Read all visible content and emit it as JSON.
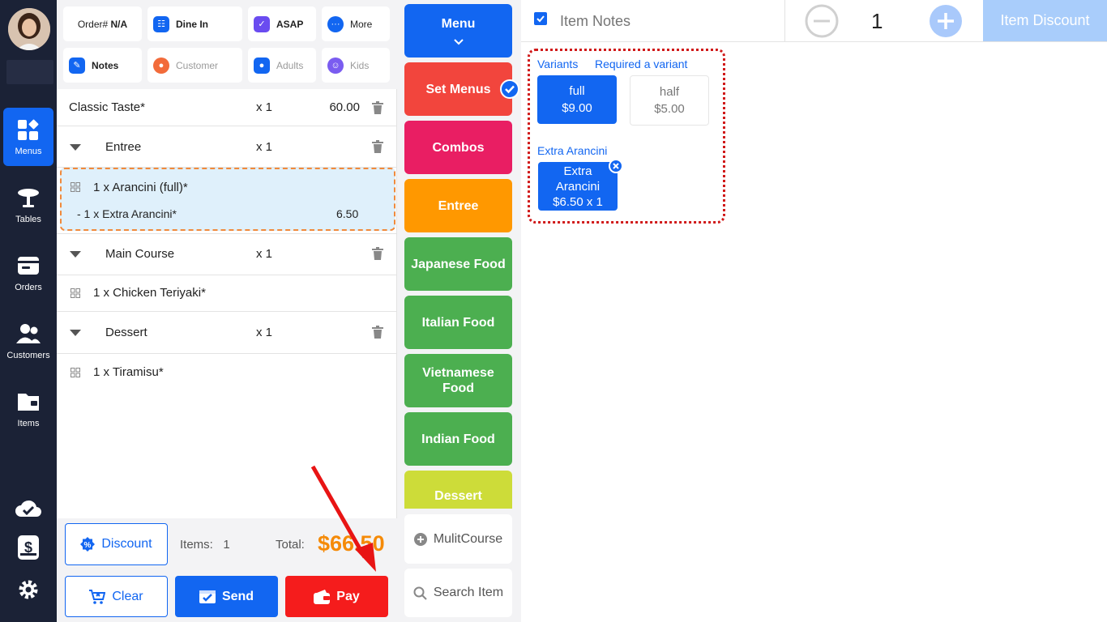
{
  "sidebar": {
    "nav": [
      {
        "label": "Menus",
        "icon": "menus-icon",
        "active": true
      },
      {
        "label": "Tables",
        "icon": "table-icon",
        "active": false
      },
      {
        "label": "Orders",
        "icon": "orders-icon",
        "active": false
      },
      {
        "label": "Customers",
        "icon": "customers-icon",
        "active": false
      },
      {
        "label": "Items",
        "icon": "folder-icon",
        "active": false
      }
    ]
  },
  "order_header": {
    "order_prefix": "Order#",
    "order_number": "N/A",
    "dine_in": "Dine In",
    "asap": "ASAP",
    "more": "More",
    "notes": "Notes",
    "customer": "Customer",
    "adults": "Adults",
    "kids": "Kids"
  },
  "order_lines": {
    "classic_name": "Classic Taste*",
    "classic_qty": "x 1",
    "classic_price": "60.00",
    "entree_name": "Entree",
    "entree_qty": "x 1",
    "arancini_name": "1 x Arancini (full)*",
    "extra_arancini_name": "- 1 x Extra Arancini*",
    "extra_arancini_price": "6.50",
    "main_name": "Main Course",
    "main_qty": "x 1",
    "teriyaki_name": "1 x Chicken Teriyaki*",
    "dessert_name": "Dessert",
    "dessert_qty": "x 1",
    "tiramisu_name": "1 x Tiramisu*"
  },
  "summary": {
    "discount_label": "Discount",
    "items_label": "Items:",
    "items_count": "1",
    "total_label": "Total:",
    "total_value": "$66.50",
    "clear_label": "Clear",
    "send_label": "Send",
    "pay_label": "Pay"
  },
  "categories": {
    "menu": "Menu",
    "set_menus": "Set Menus",
    "combos": "Combos",
    "entree": "Entree",
    "japanese": "Japanese Food",
    "italian": "Italian Food",
    "vietnamese": "Vietnamese Food",
    "indian": "Indian Food",
    "dessert": "Dessert",
    "multicourse": "MulitCourse",
    "search": "Search Item"
  },
  "item_panel": {
    "item_notes_placeholder": "Item Notes",
    "quantity": "1",
    "item_discount": "Item Discount",
    "variants_label": "Variants",
    "required_label": "Required a variant",
    "variant_full_name": "full",
    "variant_full_price": "$9.00",
    "variant_half_name": "half",
    "variant_half_price": "$5.00",
    "extra_group_label": "Extra Arancini",
    "extra_line1": "Extra",
    "extra_line2": "Arancini",
    "extra_line3": "$6.50 x 1"
  },
  "colors": {
    "primary": "#1266f1",
    "sidebar": "#1b2236",
    "set_menus": "#f2453d",
    "combos": "#e91e63",
    "entree": "#ff9800",
    "green": "#4caf50",
    "dessert": "#cddc39",
    "pay": "#f51c1c",
    "total": "#f58a07"
  }
}
